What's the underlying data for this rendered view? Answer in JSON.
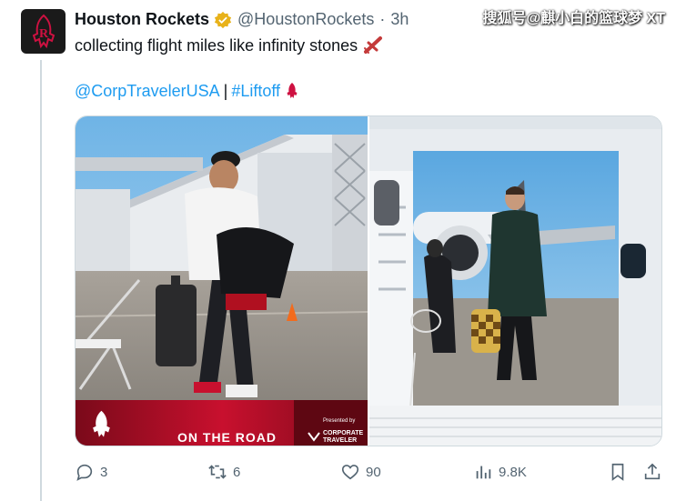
{
  "tweet": {
    "author_name": "Houston Rockets",
    "handle": "@HoustonRockets",
    "separator": "·",
    "time": "3h",
    "text": "collecting flight miles like infinity stones",
    "mention": "@CorpTravelerUSA",
    "divider": "|",
    "hashtag": "#Liftoff"
  },
  "watermark": "搜狐号@麒小白的篮球梦",
  "watermark_tail": "XT",
  "media": {
    "left_banner": "ON THE ROAD",
    "sponsor_presented": "Presented by",
    "sponsor_name_1": "CORPORATE",
    "sponsor_name_2": "TRAVELER"
  },
  "actions": {
    "replies": "3",
    "reposts": "6",
    "likes": "90",
    "views": "9.8K"
  },
  "colors": {
    "link": "#1d9bf0",
    "muted": "#536471",
    "brand_red": "#ce1141",
    "verified_gold": "#e8b21a"
  }
}
